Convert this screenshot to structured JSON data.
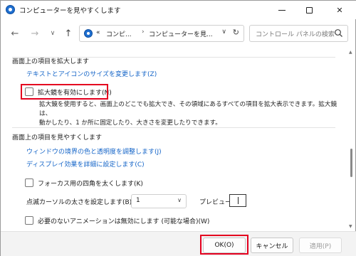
{
  "window": {
    "title": "コンピューターを見やすくします"
  },
  "nav": {
    "breadcrumb": [
      {
        "label": "«"
      },
      {
        "label": "コンピ..."
      },
      {
        "label": "コンピューターを見..."
      }
    ],
    "breadcrumb_sep": "›",
    "search_placeholder": "コントロール パネルの検索"
  },
  "sections": [
    {
      "heading": "画面上の項目を拡大します",
      "links": [
        {
          "label": "テキストとアイコンのサイズを変更します(Z)"
        }
      ],
      "checkbox": {
        "label": "拡大鏡を有効にします(N)",
        "checked": false
      },
      "description_lines": [
        "拡大鏡を使用すると、画面上のどこでも拡大でき、その領域にあるすべての項目を拡大表示できます。拡大鏡は、",
        "動かしたり、1 か所に固定したり、大きさを変更したりできます。"
      ]
    },
    {
      "heading": "画面上の項目を見やすくします",
      "links": [
        {
          "label": "ウィンドウの境界の色と透明度を調整します(J)"
        },
        {
          "label": "ディスプレイ効果を詳細に設定します(C)"
        }
      ],
      "focus_checkbox": {
        "label": "フォーカス用の四角を太くします(K)",
        "checked": false
      },
      "cursor_thickness": {
        "label": "点滅カーソルの太さを設定します(B):",
        "value": "1",
        "preview_label": "プレビュー:"
      },
      "animation_checkbox": {
        "label": "必要のないアニメーションは無効にします (可能な場合)(W)",
        "checked": false
      }
    }
  ],
  "footer": {
    "ok": "OK(O)",
    "cancel": "キャンセル",
    "apply": "適用(P)"
  },
  "colors": {
    "link": "#1565c8",
    "highlight": "#e4001f",
    "accent_icon": "#1f6fd0"
  }
}
